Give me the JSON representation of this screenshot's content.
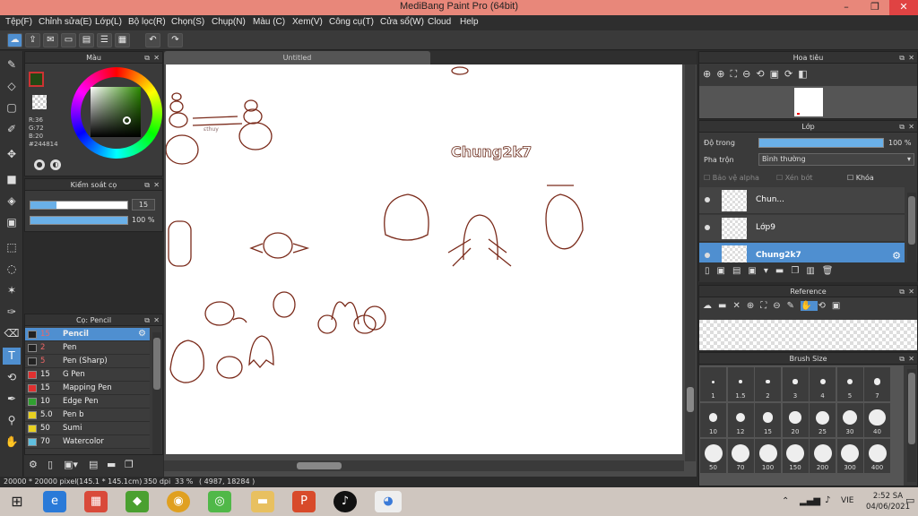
{
  "window": {
    "title": "MediBang Paint Pro (64bit)",
    "minimize": "–",
    "restore": "❐",
    "close": "✕"
  },
  "menu": [
    "Tệp(F)",
    "Chỉnh sửa(E)",
    "Lớp(L)",
    "Bộ lọc(R)",
    "Chọn(S)",
    "Chụp(N)",
    "Màu (C)",
    "Xem(V)",
    "Công cụ(T)",
    "Cửa sổ(W)",
    "Cloud",
    "Help"
  ],
  "canvas": {
    "tab_title": "Untitled",
    "artwork_text": "Chung2k7",
    "watermark": "ɛthuy"
  },
  "color_panel": {
    "title": "Màu",
    "r": "R:36",
    "g": "G:72",
    "b": "B:20",
    "hex": "#244814"
  },
  "control_panel": {
    "title": "Kiểm soát cọ",
    "size_value": "15",
    "size_fill": 0.27,
    "opacity_value": "100 %",
    "opacity_fill": 1.0
  },
  "brush_panel": {
    "title": "Cọ: Pencil",
    "brushes": [
      {
        "size": "15",
        "name": "Pencil",
        "color": "#222222",
        "selected": true
      },
      {
        "size": "2",
        "name": "Pen",
        "color": "#222222"
      },
      {
        "size": "5",
        "name": "Pen (Sharp)",
        "color": "#222222"
      },
      {
        "size": "15",
        "name": "G Pen",
        "color": "#e03030"
      },
      {
        "size": "15",
        "name": "Mapping Pen",
        "color": "#e03030"
      },
      {
        "size": "10",
        "name": "Edge Pen",
        "color": "#30a030"
      },
      {
        "size": "5.0",
        "name": "Pen b",
        "color": "#e8d020"
      },
      {
        "size": "50",
        "name": "Sumi",
        "color": "#e8d020"
      },
      {
        "size": "70",
        "name": "Watercolor",
        "color": "#60c0e0"
      }
    ]
  },
  "navigator": {
    "title": "Hoa tiêu"
  },
  "layer_panel": {
    "title": "Lớp",
    "opacity_label": "Độ trong",
    "opacity_value": "100 %",
    "blend_label": "Pha trộn",
    "blend_value": "Bình thường",
    "protect_alpha": "Bảo vệ alpha",
    "clipping": "Xén bớt",
    "lock": "Khóa",
    "layers": [
      {
        "name": "Chun..."
      },
      {
        "name": "Lớp9"
      },
      {
        "name": "Chung2k7",
        "selected": true
      }
    ]
  },
  "reference_panel": {
    "title": "Reference"
  },
  "brush_size_panel": {
    "title": "Brush Size",
    "sizes": [
      "1",
      "1.5",
      "2",
      "3",
      "4",
      "5",
      "7",
      "10",
      "12",
      "15",
      "20",
      "25",
      "30",
      "40",
      "50",
      "70",
      "100",
      "150",
      "200",
      "300",
      "400"
    ]
  },
  "status": {
    "dimensions": "20000 * 20000 pixel",
    "physical": "(145.1 * 145.1cm)",
    "dpi": "350 dpi",
    "zoom": "33 %",
    "coords": "( 4987, 18284 )"
  },
  "taskbar": {
    "time": "2:52 SA",
    "date": "04/06/2021",
    "lang": "VIE"
  }
}
